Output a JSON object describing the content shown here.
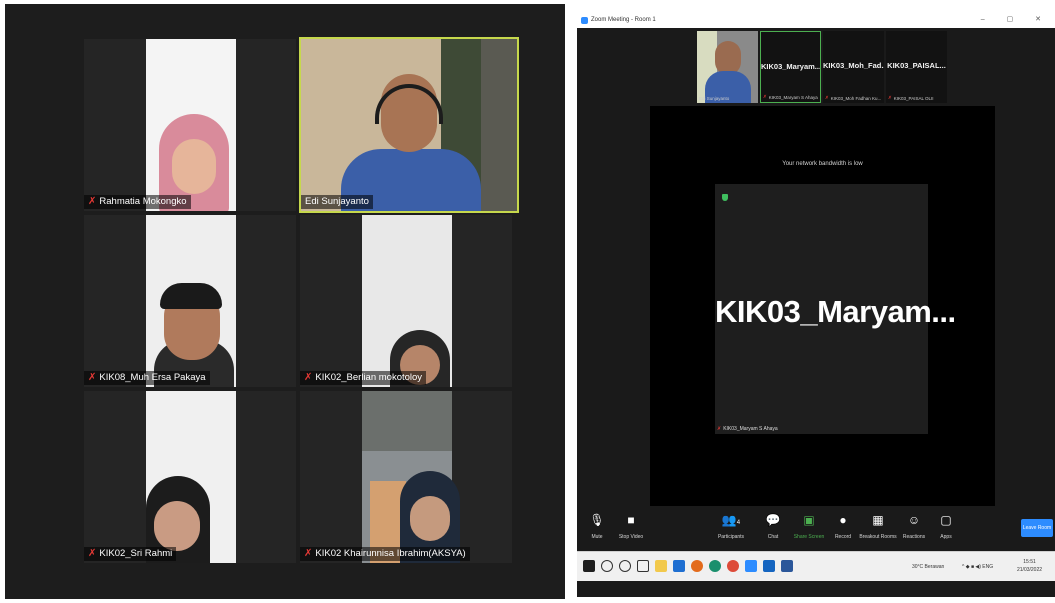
{
  "gallery": {
    "tiles": [
      {
        "name": "Rahmatia Mokongko",
        "muted": true
      },
      {
        "name": "Edi Sunjayanto",
        "muted": false,
        "active": true
      },
      {
        "name": "KIK08_Muh Ersa Pakaya",
        "muted": true
      },
      {
        "name": "KIK02_Berlian mokotoloy",
        "muted": true
      },
      {
        "name": "KIK02_Sri Rahmi",
        "muted": true
      },
      {
        "name": "KIK02 Khairunnisa Ibrahim(AKSYA)",
        "muted": true
      }
    ]
  },
  "meeting_window": {
    "title": "Zoom Meeting - Room 1",
    "strip": [
      {
        "label": "",
        "footer": "Edi Sunjayanto"
      },
      {
        "label": "KIK03_Maryam...",
        "footer": "KIK03_Maryam S Ahaya"
      },
      {
        "label": "KIK03_Moh_Fad...",
        "footer": "KIK03_Moh Fadhan Ku..."
      },
      {
        "label": "KIK03_PAISAL...",
        "footer": "KIK03_PAISAL OLII"
      }
    ],
    "bandwidth_notice": "Your network bandwidth is low",
    "speaker_name": "KIK03_Maryam...",
    "speaker_footer": "KIK03_Maryam S Ahaya",
    "toolbar": {
      "mute": "Mute",
      "stop_video": "Stop Video",
      "participants": "Participants",
      "participants_count": "4",
      "chat": "Chat",
      "share_screen": "Share Screen",
      "record": "Record",
      "breakout_rooms": "Breakout Rooms",
      "reactions": "Reactions",
      "apps": "Apps",
      "leave": "Leave Room"
    },
    "taskbar": {
      "weather": "30°C Berawan",
      "language": "ENG",
      "time": "15:51",
      "date": "21/03/2022"
    }
  },
  "colors": {
    "active_speaker_border": "#c6d84c",
    "zoom_blue": "#2d8cff",
    "share_green": "#4caf50",
    "muted_red": "#e53935"
  }
}
